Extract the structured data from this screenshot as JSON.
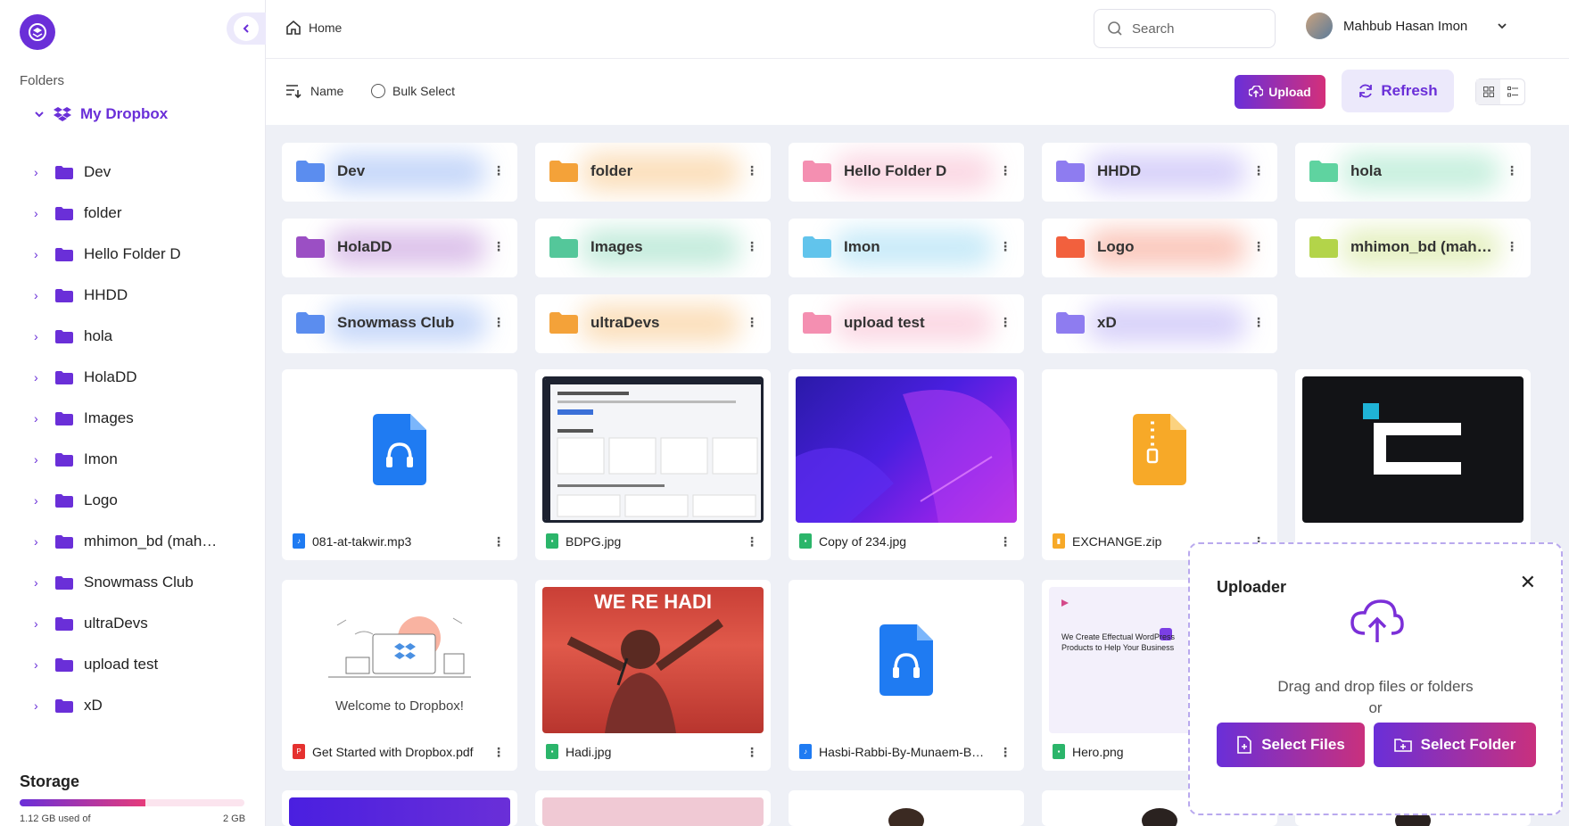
{
  "sidebar": {
    "folders_label": "Folders",
    "root": "My Dropbox",
    "items": [
      {
        "label": "Dev"
      },
      {
        "label": "folder"
      },
      {
        "label": "Hello Folder D"
      },
      {
        "label": "HHDD"
      },
      {
        "label": "hola"
      },
      {
        "label": "HolaDD"
      },
      {
        "label": "Images"
      },
      {
        "label": "Imon"
      },
      {
        "label": "Logo"
      },
      {
        "label": "mhimon_bd (mah…"
      },
      {
        "label": "Snowmass Club"
      },
      {
        "label": "ultraDevs"
      },
      {
        "label": "upload test"
      },
      {
        "label": "xD"
      }
    ],
    "storage": {
      "title": "Storage",
      "used": "1.12 GB used of",
      "total": "2 GB",
      "fraction": 0.56
    }
  },
  "header": {
    "breadcrumb": "Home",
    "search_placeholder": "Search",
    "user_name": "Mahbub Hasan Imon"
  },
  "toolbar": {
    "sort_label": "Name",
    "bulk_label": "Bulk Select",
    "upload_label": "Upload",
    "refresh_label": "Refresh"
  },
  "folders": [
    {
      "name": "Dev",
      "color": "#5b8def"
    },
    {
      "name": "folder",
      "color": "#f4a23a"
    },
    {
      "name": "Hello Folder D",
      "color": "#f48fb1"
    },
    {
      "name": "HHDD",
      "color": "#8e7cf0"
    },
    {
      "name": "hola",
      "color": "#5fd3a0"
    },
    {
      "name": "HolaDD",
      "color": "#9b4fc4"
    },
    {
      "name": "Images",
      "color": "#54c79a"
    },
    {
      "name": "Imon",
      "color": "#62c4ec"
    },
    {
      "name": "Logo",
      "color": "#f2603e"
    },
    {
      "name": "mhimon_bd (mah…",
      "color": "#b3d44a"
    },
    {
      "name": "Snowmass Club",
      "color": "#5b8def"
    },
    {
      "name": "ultraDevs",
      "color": "#f4a23a"
    },
    {
      "name": "upload test",
      "color": "#f48fb1"
    },
    {
      "name": "xD",
      "color": "#8e7cf0"
    }
  ],
  "files": [
    {
      "name": "081-at-takwir.mp3",
      "type": "audio",
      "badge_color": "#1f7bf2"
    },
    {
      "name": "BDPG.jpg",
      "type": "image",
      "badge_color": "#2bb56a"
    },
    {
      "name": "Copy of 234.jpg",
      "type": "image",
      "badge_color": "#2bb56a"
    },
    {
      "name": "EXCHANGE.zip",
      "type": "zip",
      "badge_color": "#f7a928"
    },
    {
      "name": "",
      "type": "image",
      "badge_color": "#2bb56a"
    },
    {
      "name": "Get Started with Dropbox.pdf",
      "type": "pdf",
      "badge_color": "#e5312f",
      "thumb_caption": "Welcome to Dropbox!"
    },
    {
      "name": "Hadi.jpg",
      "type": "image",
      "badge_color": "#2bb56a",
      "thumb_caption": "WE RE HADI"
    },
    {
      "name": "Hasbi-Rabbi-By-Munaem-B…",
      "type": "audio",
      "badge_color": "#1f7bf2"
    },
    {
      "name": "Hero.png",
      "type": "image",
      "badge_color": "#2bb56a",
      "thumb_caption": "We Create Effectual WordPress Products to Help Your Business"
    }
  ],
  "uploader": {
    "title": "Uploader",
    "hint_line1": "Drag and drop files or folders",
    "hint_line2": "or",
    "select_files": "Select Files",
    "select_folder": "Select Folder"
  }
}
